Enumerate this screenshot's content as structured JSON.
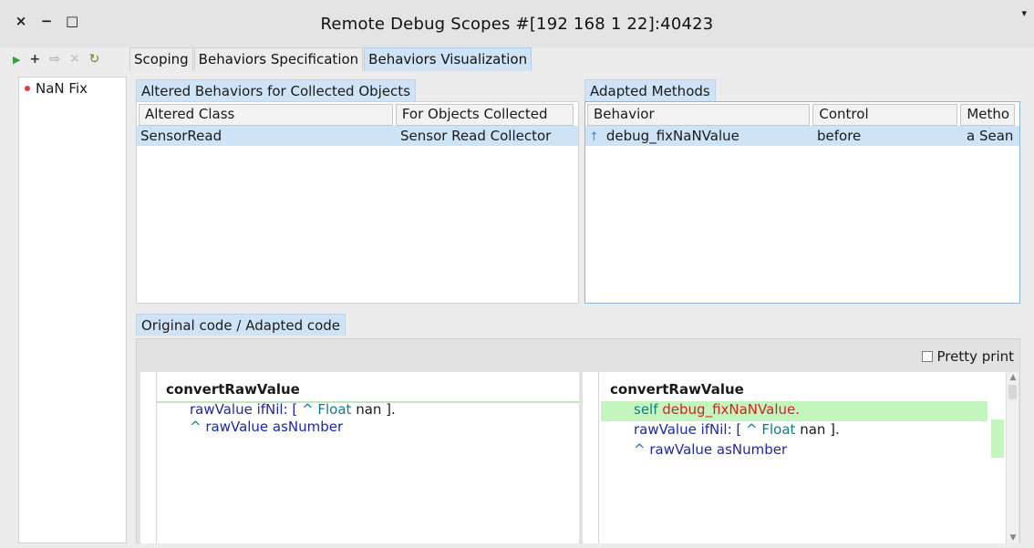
{
  "window": {
    "close_label": "×",
    "minimize_label": "−",
    "maximize_label": "□",
    "title": "Remote Debug Scopes #[192 168 1 22]:40423",
    "menu_label": "▾"
  },
  "toolbar": {
    "icons": [
      "play-icon",
      "plus-icon",
      "document-arrow-icon",
      "remove-icon",
      "refresh-icon"
    ],
    "tabs": [
      {
        "label": "Scoping",
        "active": false
      },
      {
        "label": "Behaviors Specification",
        "active": false
      },
      {
        "label": "Behaviors Visualization",
        "active": true
      }
    ]
  },
  "sidebar": {
    "items": [
      {
        "label": "NaN Fix",
        "status_color": "#e23b3b"
      }
    ]
  },
  "altered_behaviors": {
    "title": "Altered Behaviors for Collected Objects",
    "columns": [
      "Altered Class",
      "For Objects Collected"
    ],
    "rows": [
      {
        "cells": [
          "SensorRead",
          "Sensor Read Collector"
        ],
        "selected": true
      }
    ]
  },
  "adapted_methods": {
    "title": "Adapted Methods",
    "columns": [
      "Behavior",
      "Control",
      "Metho"
    ],
    "rows": [
      {
        "icon": "arrow-up-icon",
        "cells": [
          "debug_fixNaNValue",
          "before",
          "a Sean"
        ],
        "selected": true
      }
    ]
  },
  "code_view": {
    "title": "Original code / Adapted code",
    "pretty_print_label": "Pretty print",
    "pretty_print_checked": false,
    "original": {
      "method_name": "convertRawValue",
      "line1": {
        "a": "rawValue ifNil: [ ",
        "b": "^ ",
        "c": "Float",
        "d": " nan ]."
      },
      "line2": {
        "a": "^ ",
        "b": "rawValue asNumber"
      }
    },
    "adapted": {
      "method_name": "convertRawValue",
      "line1": {
        "a": "self ",
        "b": "debug_fixNaNValue",
        "c": "."
      },
      "line2": {
        "a": "rawValue ifNil: [ ",
        "b": "^ ",
        "c": "Float",
        "d": " nan ]."
      },
      "line3": {
        "a": "^ ",
        "b": "rawValue asNumber"
      }
    }
  }
}
